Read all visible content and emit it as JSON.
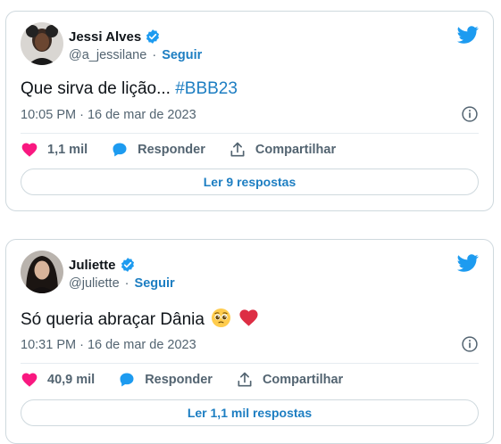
{
  "tweets": [
    {
      "author_name": "Jessi Alves",
      "handle": "@a_jessilane",
      "follow_label": "Seguir",
      "separator": "·",
      "text": "Que sirva de lição...",
      "hashtag": "#BBB23",
      "timestamp": "10:05 PM · 16 de mar de 2023",
      "likes": "1,1 mil",
      "reply_label": "Responder",
      "share_label": "Compartilhar",
      "replies_button": "Ler 9 respostas",
      "avatar_icon": "avatar-jessi",
      "emojis": []
    },
    {
      "author_name": "Juliette",
      "handle": "@juliette",
      "follow_label": "Seguir",
      "separator": "·",
      "text": "Só queria abraçar Dânia",
      "hashtag": "",
      "timestamp": "10:31 PM · 16 de mar de 2023",
      "likes": "40,9 mil",
      "reply_label": "Responder",
      "share_label": "Compartilhar",
      "replies_button": "Ler 1,1 mil respostas",
      "avatar_icon": "avatar-juliette",
      "emojis": [
        "pleading-face-emoji",
        "red-heart-emoji"
      ]
    }
  ],
  "colors": {
    "twitter_blue": "#1d9bf0",
    "link_blue": "#1d7ec2",
    "like_pink": "#f91880",
    "muted_text": "#536471",
    "border": "#cfd9de"
  }
}
